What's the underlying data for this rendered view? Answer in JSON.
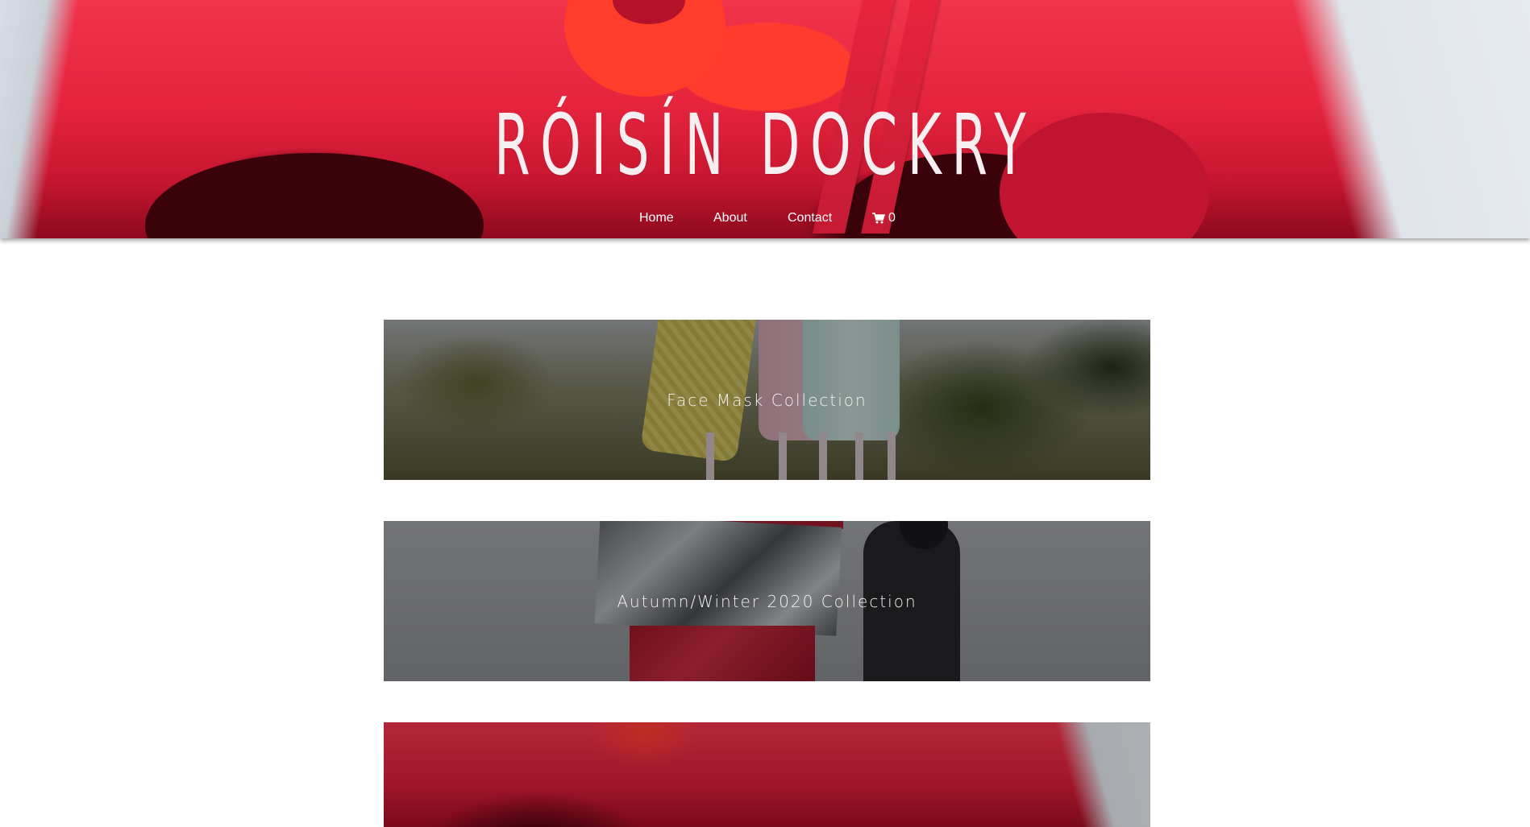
{
  "brand": {
    "title": "RÓISÍN DOCKRY"
  },
  "nav": {
    "items": [
      {
        "label": "Home"
      },
      {
        "label": "About"
      },
      {
        "label": "Contact"
      }
    ],
    "cart": {
      "icon": "cart-icon",
      "count": "0"
    }
  },
  "collections": [
    {
      "title": "Face Mask Collection"
    },
    {
      "title": "Autumn/Winter 2020 Collection"
    },
    {
      "title": ""
    }
  ],
  "colors": {
    "hero_red": "#e5233d",
    "text_white": "#ffffff"
  }
}
